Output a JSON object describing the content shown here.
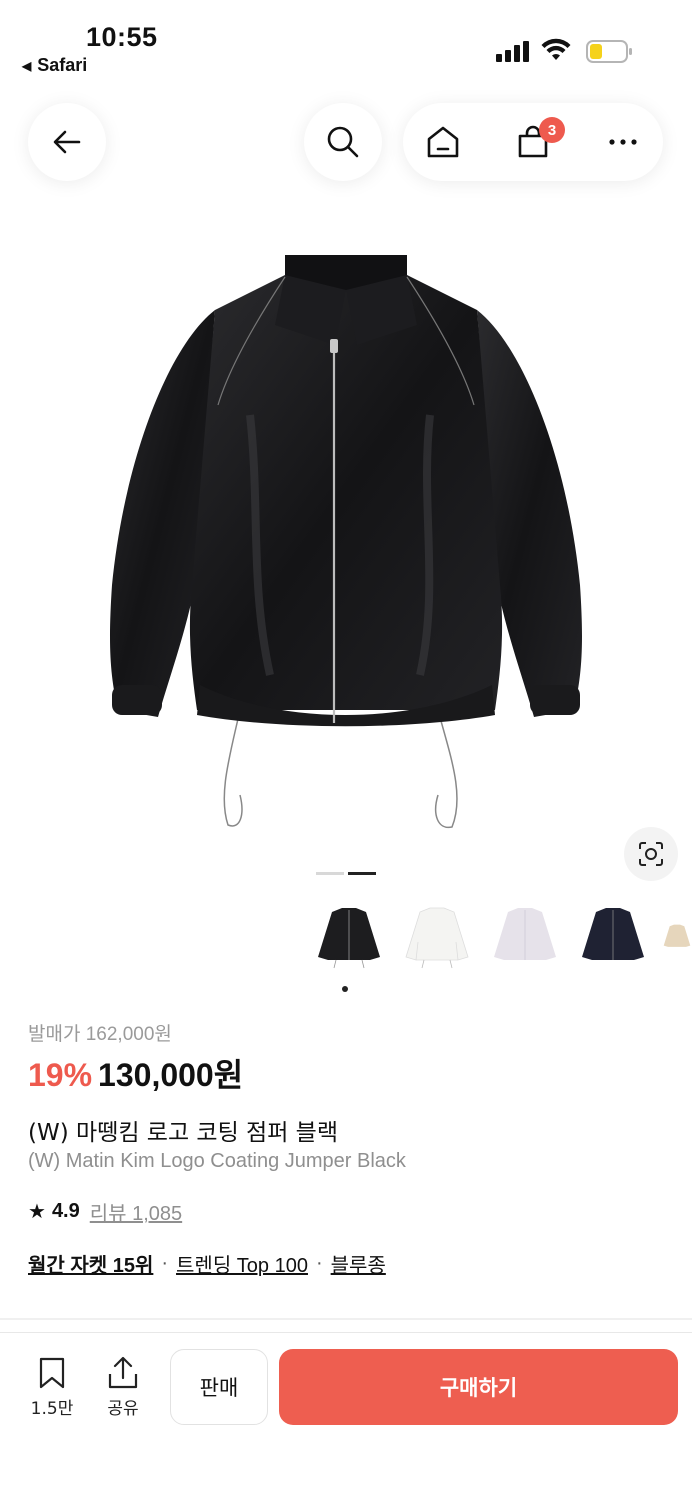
{
  "status_bar": {
    "time": "10:55",
    "back_app": "Safari",
    "back_arrow": "◀"
  },
  "nav": {
    "back_icon": "arrow-left-icon",
    "search_icon": "search-icon",
    "home_icon": "home-icon",
    "cart_icon": "shopping-bag-icon",
    "cart_count": "3",
    "more_icon": "more-horizontal-icon"
  },
  "gallery": {
    "total_pages": 2,
    "current_page": 2,
    "lens_icon": "camera-scan-icon"
  },
  "colors_options": [
    {
      "name": "black",
      "color": "#1d1d1f",
      "selected": true
    },
    {
      "name": "white",
      "color": "#f4f4f2",
      "selected": false
    },
    {
      "name": "lavender",
      "color": "#e6e2ea",
      "selected": false
    },
    {
      "name": "navy",
      "color": "#1f2233",
      "selected": false
    },
    {
      "name": "beige",
      "color": "#e6d6bc",
      "selected": false
    }
  ],
  "product": {
    "original_label": "발매가 162,000원",
    "discount": "19%",
    "price": "130,000원",
    "title_ko": "(W) 마뗑킴 로고 코팅 점퍼 블랙",
    "title_en": "(W) Matin Kim Logo Coating Jumper Black",
    "star": "★",
    "rating": "4.9",
    "review_label": "리뷰 1,085",
    "tags": [
      "월간 자켓 15위",
      "트렌딩 Top 100",
      "블루종"
    ],
    "separator": "·"
  },
  "bottom_bar": {
    "like_count": "1.5만",
    "share_label": "공유",
    "sell_label": "판매",
    "buy_label": "구매하기"
  },
  "theme": {
    "accent": "#ee5a4e",
    "buy_button": "#ee5e50"
  }
}
